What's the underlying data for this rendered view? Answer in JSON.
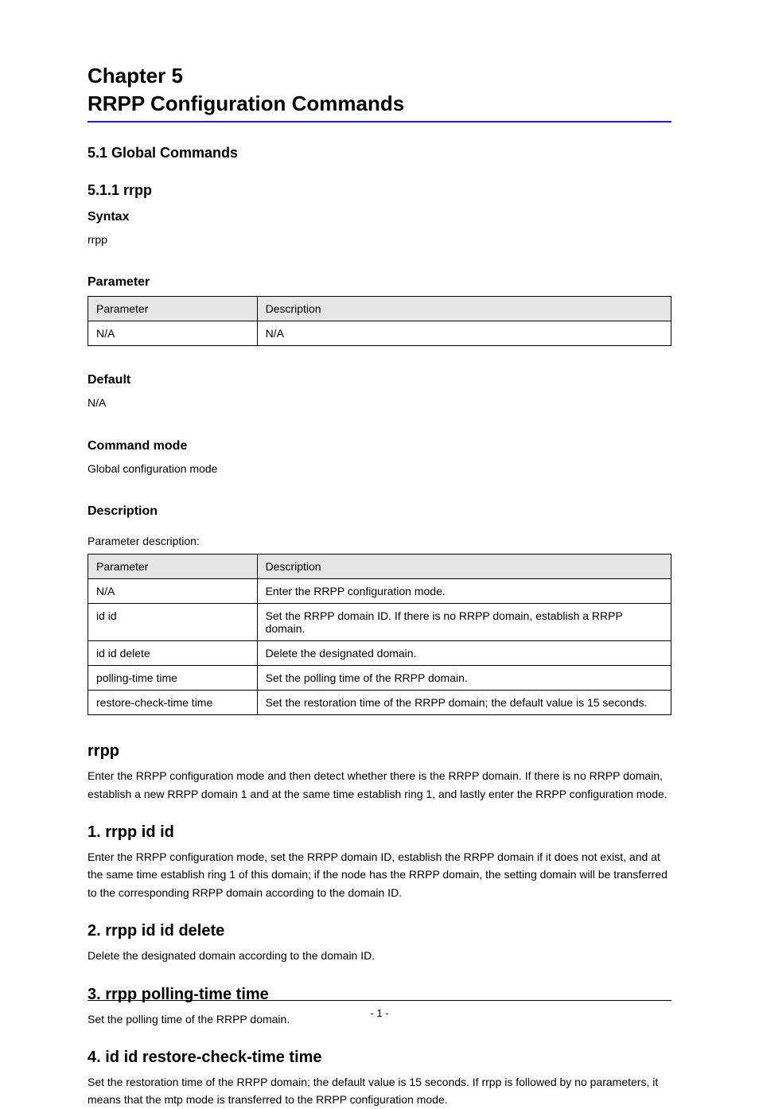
{
  "chapter": {
    "number": "Chapter 5",
    "title": "RRPP Configuration Commands"
  },
  "sections": {
    "global_title": "5.1 Global Commands",
    "cmd_heading": "5.1.1 rrpp",
    "syntax_title": "Syntax",
    "syntax_text": "rrpp",
    "parameter_title": "Parameter",
    "table1": {
      "headers": [
        "Parameter",
        "Description"
      ],
      "rows": [
        [
          "N/A",
          "N/A"
        ]
      ]
    },
    "default_title": "Default",
    "default_text": "N/A",
    "mode_title": "Command mode",
    "mode_text": "Global configuration mode",
    "desc_title": "Description",
    "desc_label": "Parameter description:"
  },
  "table2": {
    "headers": [
      "Parameter",
      "Description"
    ],
    "rows": [
      [
        "N/A",
        "Enter the RRPP configuration mode."
      ],
      [
        "id id",
        "Set the RRPP domain ID. If there is no RRPP domain, establish a RRPP domain."
      ],
      [
        "id id delete",
        "Delete the designated domain."
      ],
      [
        "polling-time time",
        "Set the polling time of the RRPP domain."
      ],
      [
        "restore-check-time time",
        "Set the restoration time of the RRPP domain; the default value is 15 seconds."
      ]
    ]
  },
  "body": {
    "p1_title": "rrpp",
    "p1_text": "Enter the RRPP configuration mode and then detect whether there is the RRPP domain. If there is no RRPP domain, establish a new RRPP domain 1 and at the same time establish ring 1, and lastly enter the RRPP configuration mode.",
    "p2_title": "1. rrpp id id",
    "p2_text": "Enter the RRPP configuration mode, set the RRPP domain ID, establish the RRPP domain if it does not exist, and at the same time establish ring 1 of this domain; if the node has the RRPP domain, the setting domain will be transferred to the corresponding RRPP domain according to the domain ID.",
    "p3_title": "2. rrpp id id delete",
    "p3_text": "Delete the designated domain according to the domain ID.",
    "p4_title": "3. rrpp polling-time time",
    "p4_text": "Set the polling time of the RRPP domain.",
    "p5_title": "4. id id restore-check-time time",
    "p5_text": "Set the restoration time of the RRPP domain; the default value is 15 seconds. If rrpp is followed by no parameters, it means that the mtp mode is transferred to the RRPP configuration mode."
  },
  "footer": {
    "page": "- 1 -"
  }
}
